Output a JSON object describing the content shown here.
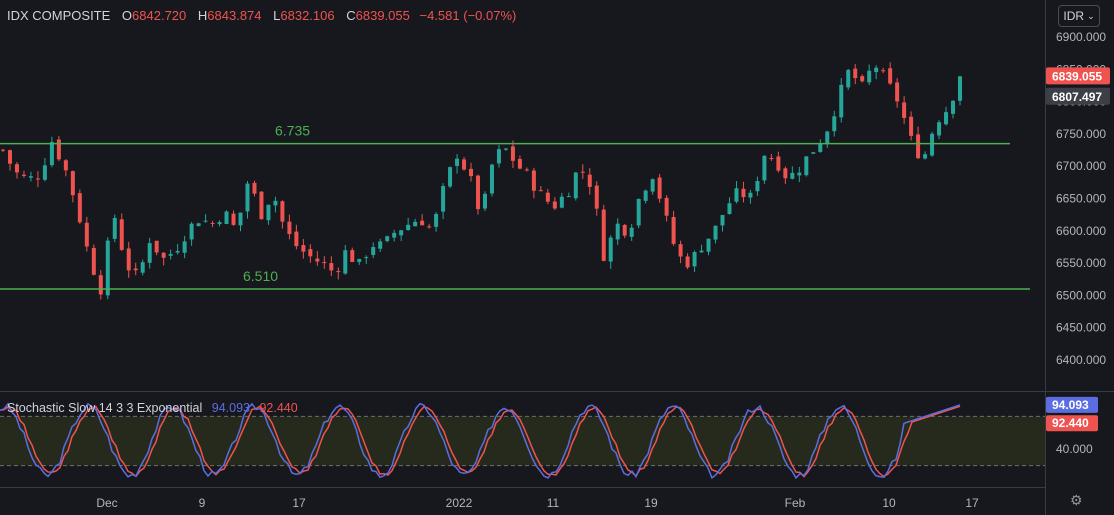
{
  "header": {
    "symbol": "IDX COMPOSITE",
    "o_label": "O",
    "o_value": "6842.720",
    "h_label": "H",
    "h_value": "6843.874",
    "l_label": "L",
    "l_value": "6832.106",
    "c_label": "C",
    "c_value": "6839.055",
    "change": "−4.581 (−0.07%)"
  },
  "currency_button": "IDR",
  "colors": {
    "up": "#26a69a",
    "down": "#ef5350",
    "level_line": "#4caf50",
    "k_line": "#5b6ee1",
    "d_line": "#ef5350",
    "background": "#17181d"
  },
  "chart_data": {
    "type": "candlestick",
    "y_axis_ticks": [
      "6400.000",
      "6450.000",
      "6500.000",
      "6550.000",
      "6600.000",
      "6650.000",
      "6700.000",
      "6750.000",
      "6800.000",
      "6850.000",
      "6900.000"
    ],
    "ylim": [
      6355,
      6920
    ],
    "x_axis_labels": [
      "Dec",
      "9",
      "17",
      "2022",
      "11",
      "19",
      "Feb",
      "10",
      "17"
    ],
    "price_labels": {
      "last_close": "6839.055",
      "secondary": "6807.497"
    },
    "levels": [
      {
        "label": "6.735",
        "value": 6735
      },
      {
        "label": "6.510",
        "value": 6510
      }
    ],
    "close_path": [
      6725,
      6690,
      6678,
      6688,
      6740,
      6700,
      6640,
      6560,
      6510,
      6630,
      6550,
      6525,
      6590,
      6555,
      6570,
      6600,
      6620,
      6610,
      6630,
      6600,
      6680,
      6625,
      6660,
      6600,
      6575,
      6560,
      6550,
      6535,
      6570,
      6545,
      6580,
      6575,
      6600,
      6610,
      6620,
      6600,
      6670,
      6720,
      6685,
      6620,
      6715,
      6725,
      6700,
      6680,
      6650,
      6640,
      6660,
      6700,
      6670,
      6560,
      6610,
      6600,
      6660,
      6690,
      6620,
      6560,
      6550,
      6580,
      6600,
      6640,
      6660,
      6650,
      6720,
      6710,
      6680,
      6700,
      6725,
      6750,
      6800,
      6850,
      6820,
      6860,
      6830,
      6800,
      6740,
      6710,
      6770,
      6790,
      6838
    ],
    "stochastic": {
      "title": "Stochastic Slow 14 3 3 Exponential",
      "k_value": "94.093",
      "d_value": "92.440",
      "axis_tick": "40.000",
      "upper_band": 80,
      "lower_band": 20,
      "ylim": [
        0,
        100
      ]
    }
  }
}
